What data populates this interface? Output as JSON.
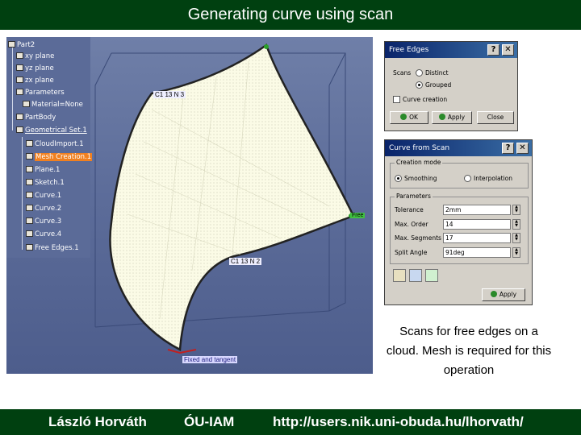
{
  "slide": {
    "title": "Generating curve using scan",
    "caption": "Scans for free edges on a cloud. Mesh is required for this operation"
  },
  "footer": {
    "author": "László Horváth",
    "institute": "ÓU-IAM",
    "url": "http://users.nik.uni-obuda.hu/lhorvath/"
  },
  "tree": {
    "items": [
      {
        "label": "Part2"
      },
      {
        "label": "xy plane"
      },
      {
        "label": "yz plane"
      },
      {
        "label": "zx plane"
      },
      {
        "label": "Parameters"
      },
      {
        "label": "Material=None"
      },
      {
        "label": "PartBody"
      },
      {
        "label": "Geometrical Set.1"
      },
      {
        "label": "CloudImport.1"
      },
      {
        "label": "Mesh Creation.1"
      },
      {
        "label": "Plane.1"
      },
      {
        "label": "Sketch.1"
      },
      {
        "label": "Curve.1"
      },
      {
        "label": "Curve.2"
      },
      {
        "label": "Curve.3"
      },
      {
        "label": "Curve.4"
      },
      {
        "label": "Free Edges.1"
      }
    ]
  },
  "viewport": {
    "tags": [
      "C1 13 N 3",
      "C1 13 N 2",
      "Fixed and tangent",
      "Free"
    ]
  },
  "free_edges_dialog": {
    "title": "Free Edges",
    "scans_label": "Scans",
    "option_distinct": "Distinct",
    "option_grouped": "Grouped",
    "curve_creation": "Curve creation",
    "ok": "OK",
    "apply": "Apply",
    "close": "Close"
  },
  "curve_scan_dialog": {
    "title": "Curve from Scan",
    "creation_mode": "Creation mode",
    "smoothing": "Smoothing",
    "interpolation": "Interpolation",
    "parameters": "Parameters",
    "tolerance_label": "Tolerance",
    "tolerance_value": "2mm",
    "max_order_label": "Max. Order",
    "max_order_value": "14",
    "max_segments_label": "Max. Segments",
    "max_segments_value": "17",
    "split_angle_label": "Split Angle",
    "split_angle_value": "91deg",
    "apply": "Apply"
  }
}
